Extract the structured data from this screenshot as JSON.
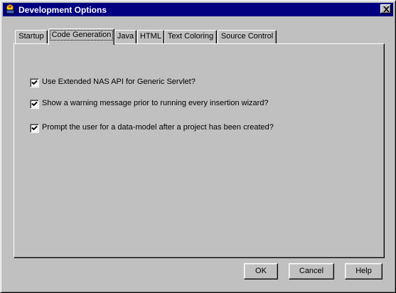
{
  "window": {
    "title": "Development Options",
    "icon": "app-icon",
    "close_icon": "close-icon"
  },
  "tabs": [
    {
      "label": "Startup",
      "active": false
    },
    {
      "label": "Code Generation",
      "active": true
    },
    {
      "label": "Java",
      "active": false
    },
    {
      "label": "HTML",
      "active": false
    },
    {
      "label": "Text Coloring",
      "active": false
    },
    {
      "label": "Source Control",
      "active": false
    }
  ],
  "options": [
    {
      "label": "Use Extended NAS API for Generic Servlet?",
      "checked": true
    },
    {
      "label": "Show a warning message prior to running every insertion wizard?",
      "checked": true
    },
    {
      "label": "Prompt the user for a data-model after a project has been created?",
      "checked": true
    }
  ],
  "buttons": {
    "ok": "OK",
    "cancel": "Cancel",
    "help": "Help"
  },
  "colors": {
    "titlebar": "#000080",
    "face": "#c0c0c0"
  }
}
